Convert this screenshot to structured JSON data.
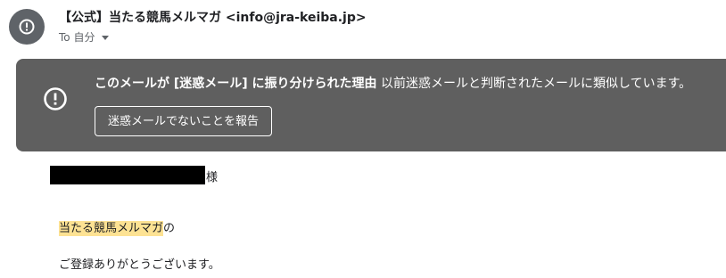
{
  "sender": {
    "name": "【公式】当たる競馬メルマガ",
    "email": "<info@jra-keiba.jp>",
    "avatar_icon": "alert-circle-icon",
    "avatar_color": "#5f6368"
  },
  "recipient": {
    "label": "To 自分",
    "toggle_icon": "caret-down-icon"
  },
  "spam_banner": {
    "icon": "alert-circle-icon",
    "reason_bold": "このメールが [迷惑メール] に振り分けられた理由",
    "reason_text": " 以前迷惑メールと判断されたメールに類似しています。",
    "report_button_label": "迷惑メールでないことを報告",
    "background_color": "#5f5f5f"
  },
  "body": {
    "honorific": "様",
    "highlighted_name": "当たる競馬メルマガ",
    "particle": "の",
    "greeting": "ご登録ありがとうございます。",
    "highlight_color": "#fde293"
  }
}
